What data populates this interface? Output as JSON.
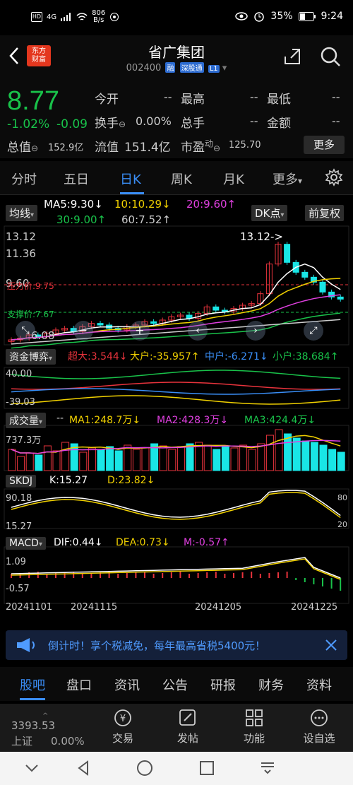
{
  "status": {
    "network": "4G",
    "speed": "806",
    "speed_unit": "B/s",
    "battery": "35%",
    "time": "9:24"
  },
  "header": {
    "logo_line1": "东方",
    "logo_line2": "财富",
    "title": "省广集团",
    "code": "002400",
    "tags": [
      "融",
      "深股通",
      "L1"
    ]
  },
  "quote": {
    "price": "8.77",
    "pct": "-1.02%",
    "change": "-0.09",
    "open_label": "今开",
    "open_val": "--",
    "high_label": "最高",
    "high_val": "--",
    "low_label": "最低",
    "low_val": "--",
    "turnover_label": "换手",
    "turnover_val": "0.00%",
    "volume_label": "总手",
    "volume_val": "--",
    "amount_label": "金额",
    "amount_val": "--",
    "mktcap_label": "总值",
    "mktcap_val": "152.9亿",
    "float_label": "流值",
    "float_val": "151.4亿",
    "pe_label": "市盈",
    "pe_sup": "动",
    "pe_val": "125.70",
    "more": "更多"
  },
  "tabs": [
    "分时",
    "五日",
    "日K",
    "周K",
    "月K",
    "更多"
  ],
  "chart": {
    "ma_chip": "均线",
    "ma5": "MA5:9.30",
    "ma10": "10:10.29",
    "ma20": "20:9.60",
    "ma30": "30:9.00",
    "ma60": "60:7.52",
    "dk": "DK点",
    "fq": "前复权",
    "y_top": "13.12",
    "y_second": "11.36",
    "y_mid": "9.60",
    "y_low": "6.08",
    "peak_label": "13.12->",
    "pressure_label": "压力价:9.75",
    "support_label": "支撑价:7.67",
    "fund_chip": "资金博弈",
    "fund_super": "超大:3.544",
    "fund_big": "大户:-35.957",
    "fund_mid": "中户:-6.271",
    "fund_small": "小户:38.684",
    "fund_top": "40.00",
    "fund_bottom": "-39.03",
    "vol_chip": "成交量",
    "vol_dash": "--",
    "vol_ma1": "MA1:248.7万",
    "vol_ma2": "MA2:428.3万",
    "vol_ma3": "MA3:424.4万",
    "vol_top": "737.3万",
    "skdj_chip": "SKDJ",
    "skdj_k": "K:15.27",
    "skdj_d": "D:23.82",
    "skdj_top": "90.18",
    "skdj_bottom": "15.27",
    "skdj_80": "80",
    "skdj_20": "20",
    "macd_chip": "MACD",
    "macd_dif": "DIF:0.44",
    "macd_dea": "DEA:0.73",
    "macd_m": "M:-0.57",
    "macd_top": "1.09",
    "macd_bottom": "-0.57",
    "dates": [
      "20241101",
      "20241115",
      "20241205",
      "20241225"
    ]
  },
  "banner": "倒计时！享个税减免，每年最高省税5400元！",
  "bottom_tabs": [
    "股吧",
    "盘口",
    "资讯",
    "公告",
    "研报",
    "财务",
    "资料"
  ],
  "index": {
    "value": "3393.53",
    "name": "上证",
    "pct": "0.00%"
  },
  "toolbar": [
    "交易",
    "发帖",
    "功能",
    "设自选"
  ],
  "colors": {
    "up": "#e8333c",
    "down": "#19c24a",
    "accent": "#3a8ef6",
    "cyan": "#19e6e6"
  }
}
